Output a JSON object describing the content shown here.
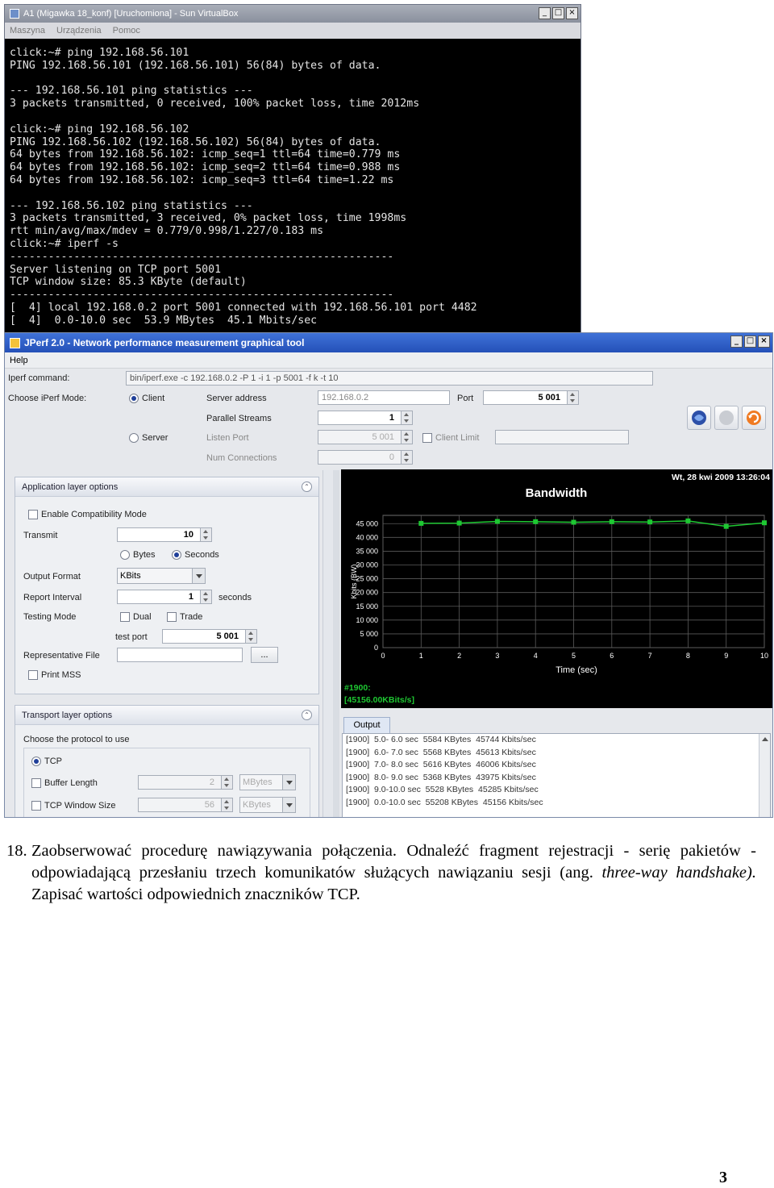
{
  "vbox": {
    "title": "A1 (Migawka 18_konf) [Uruchomiona] - Sun VirtualBox",
    "menu": [
      "Maszyna",
      "Urządzenia",
      "Pomoc"
    ],
    "window_buttons": [
      "_",
      "□",
      "×"
    ],
    "terminal_lines": [
      "click:~# ping 192.168.56.101",
      "PING 192.168.56.101 (192.168.56.101) 56(84) bytes of data.",
      "",
      "--- 192.168.56.101 ping statistics ---",
      "3 packets transmitted, 0 received, 100% packet loss, time 2012ms",
      "",
      "click:~# ping 192.168.56.102",
      "PING 192.168.56.102 (192.168.56.102) 56(84) bytes of data.",
      "64 bytes from 192.168.56.102: icmp_seq=1 ttl=64 time=0.779 ms",
      "64 bytes from 192.168.56.102: icmp_seq=2 ttl=64 time=0.988 ms",
      "64 bytes from 192.168.56.102: icmp_seq=3 ttl=64 time=1.22 ms",
      "",
      "--- 192.168.56.102 ping statistics ---",
      "3 packets transmitted, 3 received, 0% packet loss, time 1998ms",
      "rtt min/avg/max/mdev = 0.779/0.998/1.227/0.183 ms",
      "click:~# iperf -s",
      "------------------------------------------------------------",
      "Server listening on TCP port 5001",
      "TCP window size: 85.3 KByte (default)",
      "------------------------------------------------------------",
      "[  4] local 192.168.0.2 port 5001 connected with 192.168.56.101 port 4482",
      "[  4]  0.0-10.0 sec  53.9 MBytes  45.1 Mbits/sec"
    ]
  },
  "jperf": {
    "title": "JPerf 2.0 - Network performance measurement graphical tool",
    "window_buttons": [
      "_",
      "□",
      "×"
    ],
    "menu_help": "Help",
    "iperf_command_label": "Iperf command:",
    "iperf_command_value": "bin/iperf.exe -c 192.168.0.2 -P 1 -i 1 -p 5001 -f k -t 10",
    "mode_label": "Choose iPerf Mode:",
    "client_label": "Client",
    "server_label": "Server",
    "server_address_label": "Server address",
    "server_address_value": "192.168.0.2",
    "port_label": "Port",
    "port_value": "5 001",
    "parallel_label": "Parallel Streams",
    "parallel_value": "1",
    "listen_port_label": "Listen Port",
    "listen_port_value": "5 001",
    "client_limit_label": "Client Limit",
    "num_conn_label": "Num Connections",
    "num_conn_value": "0",
    "app_panel": {
      "title": "Application layer options",
      "compat_label": "Enable Compatibility Mode",
      "transmit_label": "Transmit",
      "transmit_value": "10",
      "bytes_label": "Bytes",
      "seconds_label": "Seconds",
      "output_format_label": "Output Format",
      "output_format_value": "KBits",
      "report_interval_label": "Report Interval",
      "report_interval_value": "1",
      "seconds_unit": "seconds",
      "testing_mode_label": "Testing Mode",
      "dual_label": "Dual",
      "trade_label": "Trade",
      "test_port_label": "test port",
      "test_port_value": "5 001",
      "rep_file_label": "Representative File",
      "browse_label": "...",
      "print_mss_label": "Print MSS"
    },
    "transport_panel": {
      "title": "Transport layer options",
      "protocol_label": "Choose the protocol to use",
      "tcp_label": "TCP",
      "buffer_label": "Buffer Length",
      "buffer_value": "2",
      "buffer_unit": "MBytes",
      "window_label": "TCP Window Size",
      "window_value": "56",
      "window_unit": "KBytes"
    },
    "output_tab": "Output",
    "output_lines": [
      "[1900]  5.0- 6.0 sec  5584 KBytes  45744 Kbits/sec",
      "[1900]  6.0- 7.0 sec  5568 KBytes  45613 Kbits/sec",
      "[1900]  7.0- 8.0 sec  5616 KBytes  46006 Kbits/sec",
      "[1900]  8.0- 9.0 sec  5368 KBytes  43975 Kbits/sec",
      "[1900]  9.0-10.0 sec  5528 KBytes  45285 Kbits/sec",
      "[1900]  0.0-10.0 sec  55208 KBytes  45156 Kbits/sec"
    ]
  },
  "chart_data": {
    "type": "line",
    "title": "Bandwidth",
    "timestamp": "Wt, 28 kwi 2009 13:26:04",
    "xlabel": "Time (sec)",
    "ylabel": "Kbits (BW)",
    "xlim": [
      0,
      10
    ],
    "ylim": [
      0,
      48000
    ],
    "x_ticks": [
      "0",
      "1",
      "2",
      "3",
      "4",
      "5",
      "6",
      "7",
      "8",
      "9",
      "10"
    ],
    "y_ticks": [
      "0",
      "5 000",
      "10 000",
      "15 000",
      "20 000",
      "25 000",
      "30 000",
      "35 000",
      "40 000",
      "45 000"
    ],
    "y_tick_values": [
      0,
      5000,
      10000,
      15000,
      20000,
      25000,
      30000,
      35000,
      40000,
      45000
    ],
    "grid": true,
    "series": [
      {
        "name": "#1900:",
        "legend_value": "[45156.00KBits/s]",
        "color": "#1ec832",
        "x": [
          1,
          2,
          3,
          4,
          5,
          6,
          7,
          8,
          9,
          10
        ],
        "y": [
          45100,
          45200,
          45800,
          45700,
          45500,
          45700,
          45600,
          46000,
          44000,
          45300
        ]
      }
    ]
  },
  "document": {
    "number": "18.",
    "text_part1": "Zaobserwować procedurę nawiązywania połączenia. Odnaleźć fragment rejestracji - serię pakietów - odpowiadającą przesłaniu trzech komunikatów służących nawiązaniu sesji (ang. ",
    "text_italic": "three-way handshake).",
    "text_part2": " Zapisać wartości odpowiednich znaczników TCP.",
    "page_number": "3"
  }
}
